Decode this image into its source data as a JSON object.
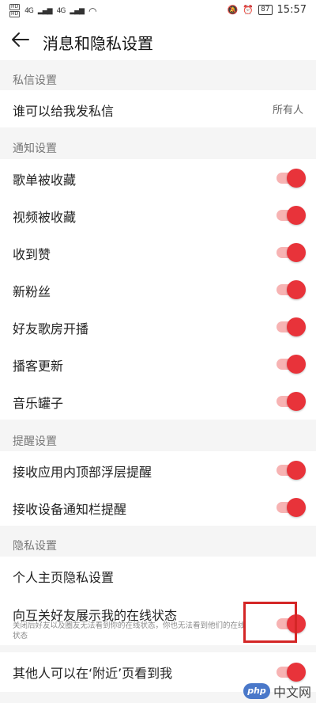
{
  "status_bar": {
    "sim1": "HD",
    "sim2": "HD",
    "net1": "4G",
    "net2": "4G",
    "battery": "87",
    "time": "15:57"
  },
  "header": {
    "title": "消息和隐私设置"
  },
  "sections": {
    "private_msg": {
      "header": "私信设置",
      "rows": [
        {
          "label": "谁可以给我发私信",
          "value": "所有人"
        }
      ]
    },
    "notify": {
      "header": "通知设置",
      "rows": [
        {
          "label": "歌单被收藏",
          "on": true
        },
        {
          "label": "视频被收藏",
          "on": true
        },
        {
          "label": "收到赞",
          "on": true
        },
        {
          "label": "新粉丝",
          "on": true
        },
        {
          "label": "好友歌房开播",
          "on": true
        },
        {
          "label": "播客更新",
          "on": true
        },
        {
          "label": "音乐罐子",
          "on": true
        }
      ]
    },
    "remind": {
      "header": "提醒设置",
      "rows": [
        {
          "label": "接收应用内顶部浮层提醒",
          "on": true
        },
        {
          "label": "接收设备通知栏提醒",
          "on": true
        }
      ]
    },
    "privacy": {
      "header": "隐私设置",
      "rows": [
        {
          "label": "个人主页隐私设置"
        },
        {
          "label": "向互关好友展示我的在线状态",
          "sub": "关闭后好友以及圈友无法看到你的在线状态，你也无法看到他们的在线状态",
          "on": true
        },
        {
          "label": "其他人可以在‘附近’页看到我",
          "on": true
        }
      ]
    }
  },
  "colors": {
    "accent": "#e8333a",
    "track": "#f7b3b3",
    "highlight": "#d42626"
  },
  "watermark": {
    "logo": "php",
    "text": "中文网"
  }
}
